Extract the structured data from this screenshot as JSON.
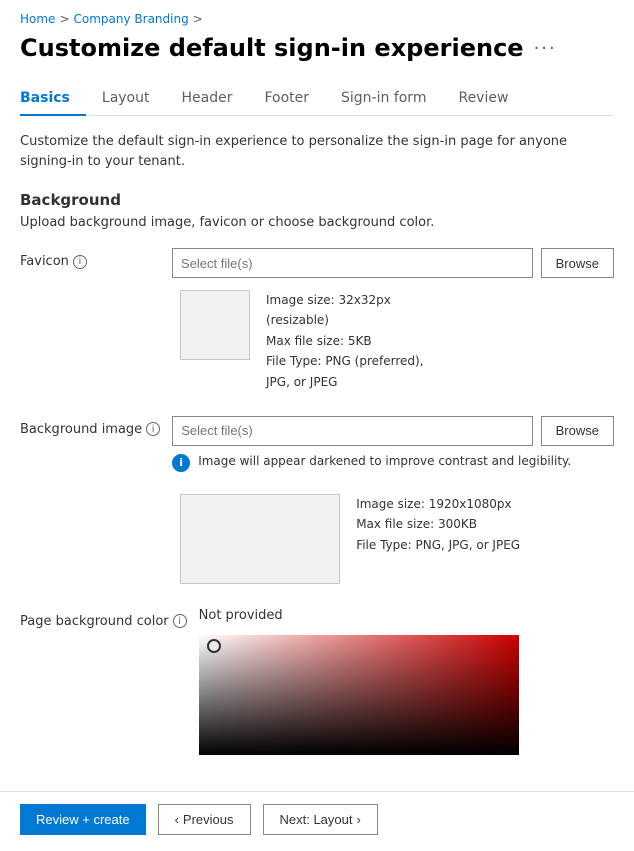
{
  "breadcrumb": {
    "home": "Home",
    "company_branding": "Company Branding",
    "separator": ">"
  },
  "page_title": "Customize default sign-in experience",
  "more_options_icon": "···",
  "tabs": [
    {
      "id": "basics",
      "label": "Basics",
      "active": true
    },
    {
      "id": "layout",
      "label": "Layout",
      "active": false
    },
    {
      "id": "header",
      "label": "Header",
      "active": false
    },
    {
      "id": "footer",
      "label": "Footer",
      "active": false
    },
    {
      "id": "sign-in-form",
      "label": "Sign-in form",
      "active": false
    },
    {
      "id": "review",
      "label": "Review",
      "active": false
    }
  ],
  "description": "Customize the default sign-in experience to personalize the sign-in page for anyone signing-in to your tenant.",
  "background_section": {
    "title": "Background",
    "subtitle": "Upload background image, favicon or choose background color."
  },
  "favicon": {
    "label": "Favicon",
    "placeholder": "Select file(s)",
    "browse_label": "Browse",
    "image_info": {
      "size": "Image size: 32x32px",
      "resizable": "(resizable)",
      "max_file_size": "Max file size: 5KB",
      "file_type": "File Type: PNG (preferred),",
      "file_type2": "JPG, or JPEG"
    }
  },
  "background_image": {
    "label": "Background image",
    "placeholder": "Select file(s)",
    "browse_label": "Browse",
    "info_banner": "Image will appear darkened to improve contrast and legibility.",
    "image_info": {
      "size": "Image size: 1920x1080px",
      "max_file_size": "Max file size: 300KB",
      "file_type": "File Type: PNG, JPG, or JPEG"
    }
  },
  "page_background_color": {
    "label": "Page background color",
    "value": "Not provided"
  },
  "bottom_bar": {
    "review_create": "Review + create",
    "previous": "Previous",
    "next": "Next: Layout",
    "chevron_left": "‹",
    "chevron_right": "›"
  }
}
